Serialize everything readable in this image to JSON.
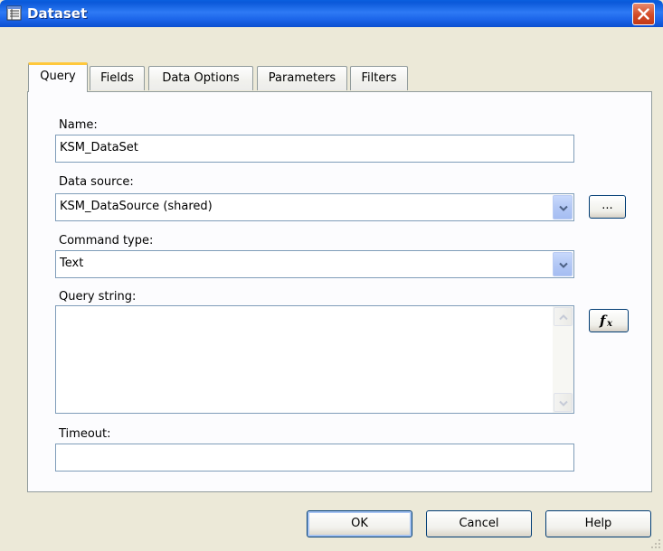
{
  "window": {
    "title": "Dataset"
  },
  "tabs": [
    {
      "label": "Query",
      "active": true
    },
    {
      "label": "Fields"
    },
    {
      "label": "Data Options"
    },
    {
      "label": "Parameters"
    },
    {
      "label": "Filters"
    }
  ],
  "form": {
    "name_label": "Name:",
    "name_value": "KSM_DataSet",
    "datasource_label": "Data source:",
    "datasource_value": "KSM_DataSource (shared)",
    "datasource_browse": "...",
    "command_type_label": "Command type:",
    "command_type_value": "Text",
    "query_label": "Query string:",
    "query_value": "",
    "timeout_label": "Timeout:",
    "timeout_value": ""
  },
  "buttons": {
    "ok": "OK",
    "cancel": "Cancel",
    "help": "Help"
  },
  "icons": {
    "title": "dataset-window-icon",
    "close": "close-icon",
    "fx": "function-fx-icon",
    "dropdown": "chevron-down-icon"
  },
  "colors": {
    "titlebar": "#1d66ea",
    "active_tab_accent": "#ffc83c",
    "close": "#d34b27"
  }
}
